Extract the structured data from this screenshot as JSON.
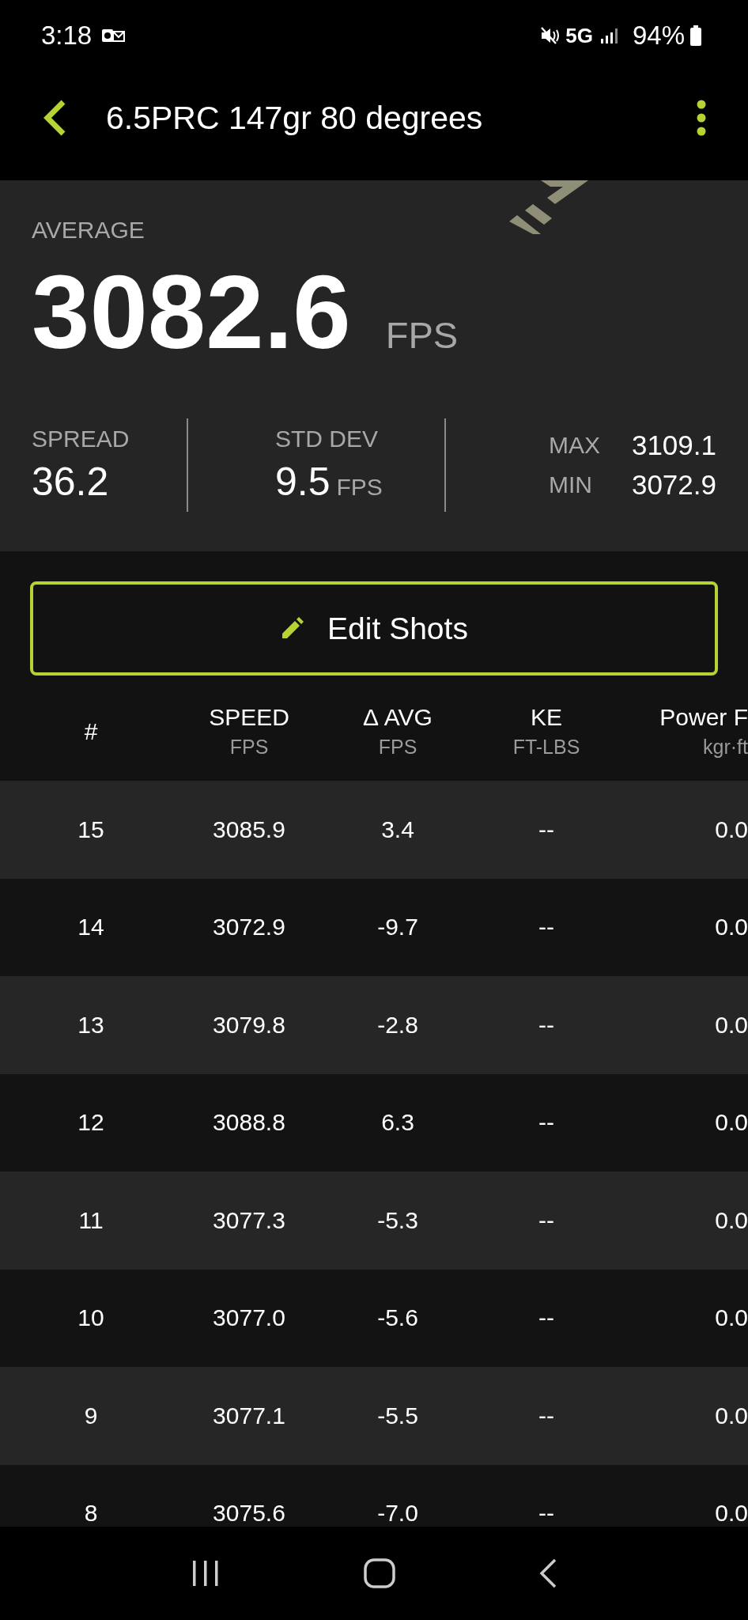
{
  "status_bar": {
    "time": "3:18",
    "network": "5G",
    "battery": "94%"
  },
  "app_bar": {
    "title": "6.5PRC 147gr 80 degrees"
  },
  "summary": {
    "average_label": "AVERAGE",
    "average": "3082.6",
    "average_unit": "FPS",
    "spread_label": "SPREAD",
    "spread": "36.2",
    "std_dev_label": "STD DEV",
    "std_dev": "9.5",
    "std_dev_unit": "FPS",
    "max_label": "MAX",
    "max": "3109.1",
    "min_label": "MIN",
    "min": "3072.9"
  },
  "edit_button": {
    "label": "Edit Shots"
  },
  "table": {
    "columns": [
      {
        "label": "#"
      },
      {
        "label": "SPEED",
        "unit": "FPS"
      },
      {
        "label": "Δ AVG",
        "unit": "FPS"
      },
      {
        "label": "KE",
        "unit": "FT-LBS"
      },
      {
        "label": "Power F",
        "unit": "kgr·ft"
      }
    ],
    "rows": [
      [
        "15",
        "3085.9",
        "3.4",
        "--",
        "0.0"
      ],
      [
        "14",
        "3072.9",
        "-9.7",
        "--",
        "0.0"
      ],
      [
        "13",
        "3079.8",
        "-2.8",
        "--",
        "0.0"
      ],
      [
        "12",
        "3088.8",
        "6.3",
        "--",
        "0.0"
      ],
      [
        "11",
        "3077.3",
        "-5.3",
        "--",
        "0.0"
      ],
      [
        "10",
        "3077.0",
        "-5.6",
        "--",
        "0.0"
      ],
      [
        "9",
        "3077.1",
        "-5.5",
        "--",
        "0.0"
      ],
      [
        "8",
        "3075.6",
        "-7.0",
        "--",
        "0.0"
      ]
    ]
  }
}
